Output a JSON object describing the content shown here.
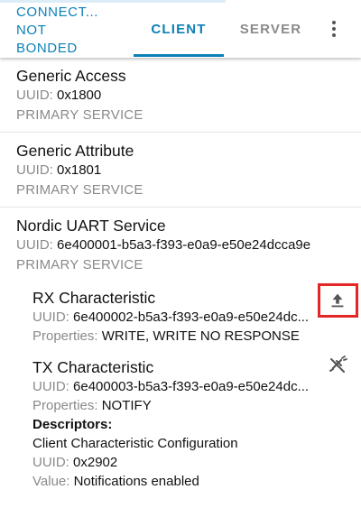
{
  "header": {
    "connection_status_line1": "CONNECT...",
    "connection_status_line2": "NOT",
    "connection_status_line3": "BONDED",
    "tabs": [
      {
        "label": "CLIENT",
        "active": true
      },
      {
        "label": "SERVER",
        "active": false
      }
    ],
    "menu_icon": "more-vert-icon"
  },
  "colors": {
    "accent": "#0d80b8",
    "muted_text": "#8a8a8a",
    "highlight": "#e32626"
  },
  "services": [
    {
      "name": "Generic Access",
      "uuid_label": "UUID:",
      "uuid": "0x1800",
      "type": "PRIMARY SERVICE"
    },
    {
      "name": "Generic Attribute",
      "uuid_label": "UUID:",
      "uuid": "0x1801",
      "type": "PRIMARY SERVICE"
    },
    {
      "name": "Nordic UART Service",
      "uuid_label": "UUID:",
      "uuid": "6e400001-b5a3-f393-e0a9-e50e24dcca9e",
      "type": "PRIMARY SERVICE",
      "characteristics": [
        {
          "name": "RX Characteristic",
          "uuid_label": "UUID:",
          "uuid": "6e400002-b5a3-f393-e0a9-e50e24dc...",
          "properties_label": "Properties:",
          "properties": "WRITE, WRITE NO RESPONSE",
          "action_icon": "upload-icon"
        },
        {
          "name": "TX Characteristic",
          "uuid_label": "UUID:",
          "uuid": "6e400003-b5a3-f393-e0a9-e50e24dc...",
          "properties_label": "Properties:",
          "properties": "NOTIFY",
          "action_icon": "notifications-off-icon",
          "descriptors_title": "Descriptors:",
          "descriptors": [
            {
              "name": "Client Characteristic Configuration",
              "uuid_label": "UUID:",
              "uuid": "0x2902",
              "value_label": "Value:",
              "value": "Notifications enabled",
              "action_icon": "download-icon"
            }
          ]
        }
      ]
    }
  ]
}
